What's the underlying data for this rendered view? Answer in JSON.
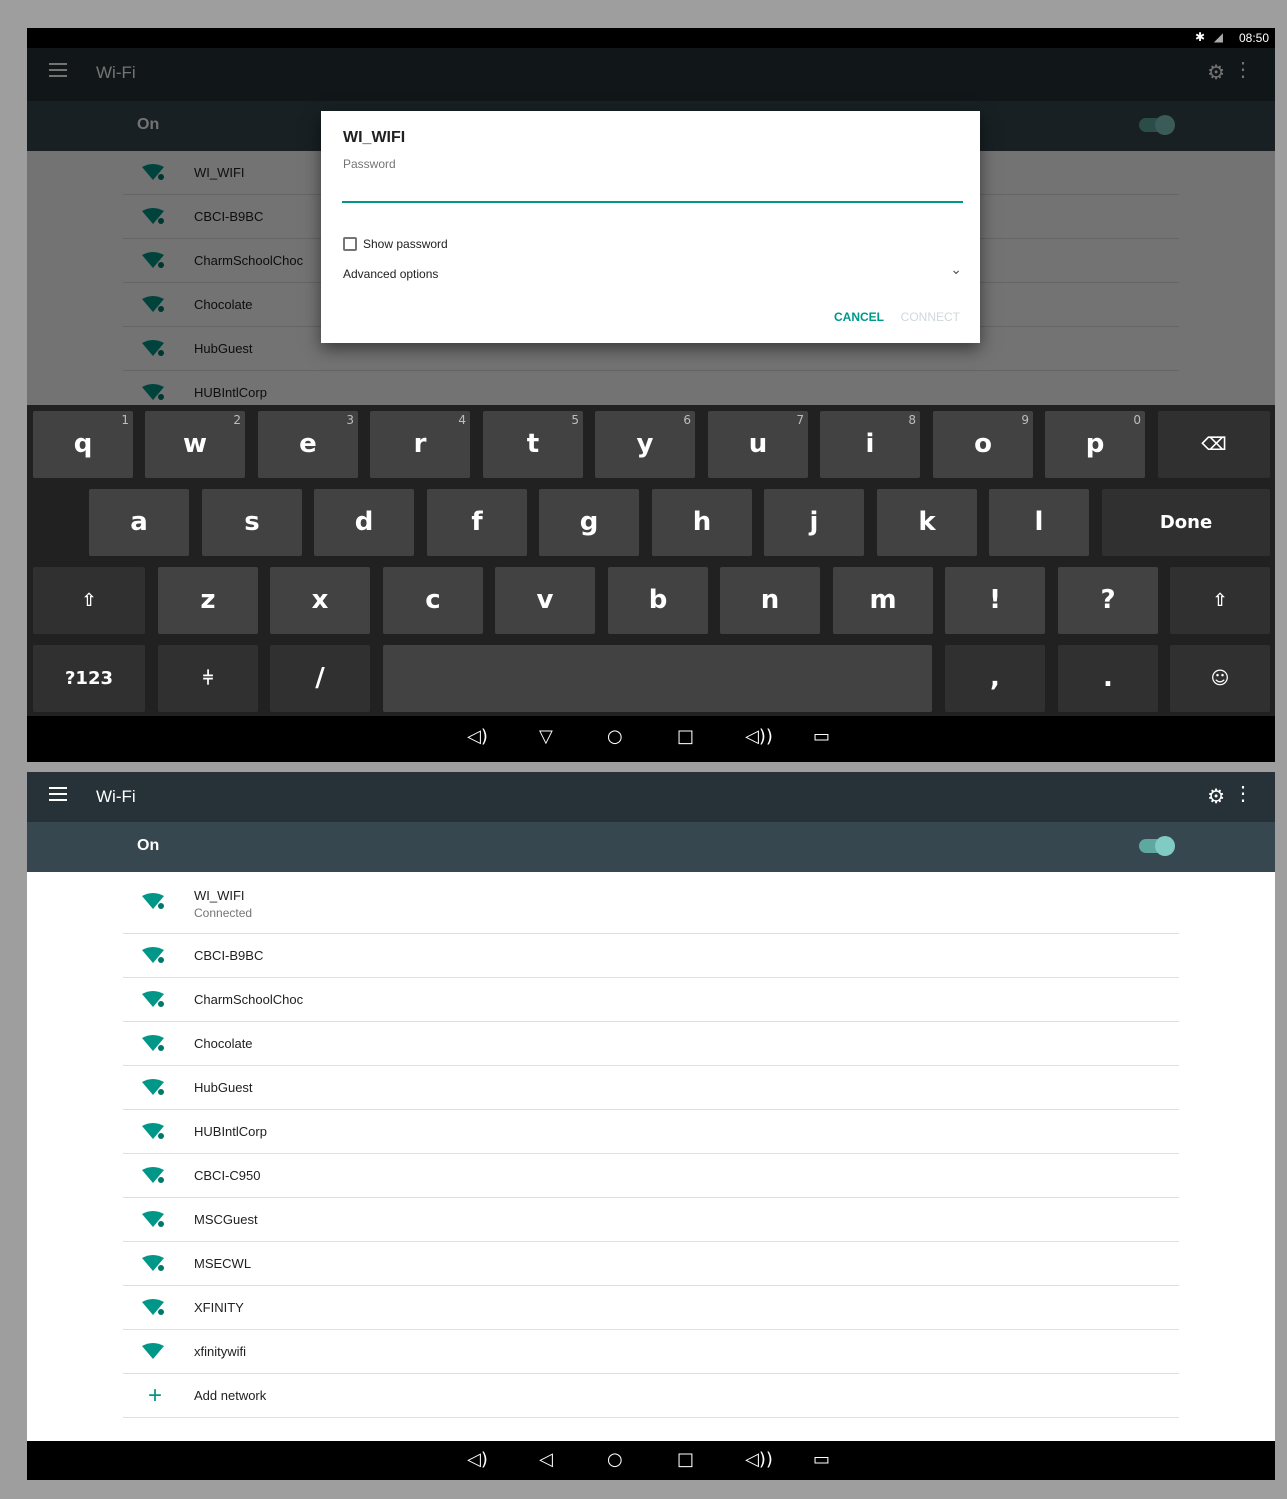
{
  "status_bar": {
    "time": "08:50",
    "bluetooth_icon": "bluetooth-icon",
    "signal_icon": "no-signal-icon"
  },
  "toolbar": {
    "title": "Wi-Fi",
    "menu_icon": "hamburger-menu-icon",
    "settings_icon": "gear-icon",
    "overflow_icon": "more-vert-icon"
  },
  "wifi_toggle": {
    "label": "On",
    "state": "on"
  },
  "dialog": {
    "title": "WI_WIFI",
    "password_label": "Password",
    "password_value": "",
    "show_password_label": "Show password",
    "advanced_label": "Advanced options",
    "cancel_label": "CANCEL",
    "connect_label": "CONNECT"
  },
  "background_networks": [
    {
      "name": "WI_WIFI"
    },
    {
      "name": "CBCI-B9BC"
    },
    {
      "name": "CharmSchoolChoc"
    },
    {
      "name": "Chocolate"
    },
    {
      "name": "HubGuest"
    },
    {
      "name": "HUBIntlCorp"
    }
  ],
  "keyboard": {
    "row1": [
      {
        "label": "q",
        "hint": "1"
      },
      {
        "label": "w",
        "hint": "2"
      },
      {
        "label": "e",
        "hint": "3"
      },
      {
        "label": "r",
        "hint": "4"
      },
      {
        "label": "t",
        "hint": "5"
      },
      {
        "label": "y",
        "hint": "6"
      },
      {
        "label": "u",
        "hint": "7"
      },
      {
        "label": "i",
        "hint": "8"
      },
      {
        "label": "o",
        "hint": "9"
      },
      {
        "label": "p",
        "hint": "0"
      }
    ],
    "row2": [
      "a",
      "s",
      "d",
      "f",
      "g",
      "h",
      "j",
      "k",
      "l"
    ],
    "done_label": "Done",
    "row3": [
      "z",
      "x",
      "c",
      "v",
      "b",
      "n",
      "m",
      "!",
      "?"
    ],
    "symbols_label": "?123",
    "slash_label": "/",
    "comma_label": ",",
    "period_label": ".",
    "backspace_icon": "backspace-icon",
    "shift_icon": "shift-icon",
    "settings_key_icon": "keyboard-settings-icon",
    "emoji_icon": "emoji-icon"
  },
  "networks": [
    {
      "name": "WI_WIFI",
      "status": "Connected",
      "signal": "full"
    },
    {
      "name": "CBCI-B9BC",
      "signal": "full"
    },
    {
      "name": "CharmSchoolChoc",
      "signal": "full"
    },
    {
      "name": "Chocolate",
      "signal": "full"
    },
    {
      "name": "HubGuest",
      "signal": "full"
    },
    {
      "name": "HUBIntlCorp",
      "signal": "full"
    },
    {
      "name": "CBCI-C950",
      "signal": "full"
    },
    {
      "name": "MSCGuest",
      "signal": "full"
    },
    {
      "name": "MSECWL",
      "signal": "full"
    },
    {
      "name": "XFINITY",
      "signal": "full"
    },
    {
      "name": "xfinitywifi",
      "signal": "open"
    }
  ],
  "add_network_label": "Add network",
  "navbar": [
    "volume-down-icon",
    "back-icon",
    "home-icon",
    "recents-icon",
    "volume-up-icon",
    "screenshot-icon"
  ],
  "colors": {
    "accent": "#009688",
    "toolbar": "#263238",
    "switchbar": "#37474f"
  }
}
